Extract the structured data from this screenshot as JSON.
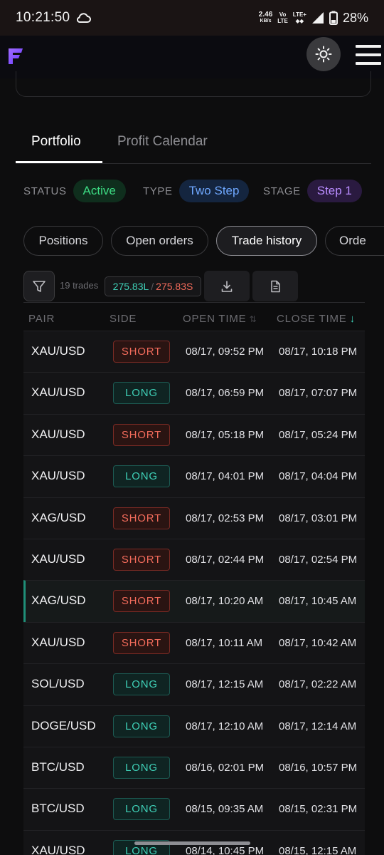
{
  "status_bar": {
    "time": "10:21:50",
    "speed_value": "2.46",
    "speed_unit": "KB/s",
    "volte_top": "Vo",
    "volte_bottom": "LTE",
    "lte_label": "LTE+",
    "battery_percent": "28%",
    "icons": [
      "cloud-icon",
      "signal-icon",
      "battery-icon"
    ]
  },
  "header": {
    "logo_icon": "brand-logo-icon",
    "theme_icon": "sun-icon",
    "menu_icon": "hamburger-menu-icon"
  },
  "tabs": {
    "portfolio": "Portfolio",
    "profit_calendar": "Profit Calendar"
  },
  "meta": {
    "status_label": "STATUS",
    "status_value": "Active",
    "type_label": "TYPE",
    "type_value": "Two Step",
    "stage_label": "STAGE",
    "stage_value": "Step 1"
  },
  "subtabs": {
    "positions": "Positions",
    "open_orders": "Open orders",
    "trade_history": "Trade history",
    "orders_partial": "Orde"
  },
  "toolbar": {
    "trades_count": "19 trades",
    "long_total": "275.83L",
    "separator": "/",
    "short_total": "275.83S",
    "icons": [
      "filter-icon",
      "download-icon",
      "document-icon"
    ]
  },
  "table": {
    "headers": {
      "pair": "PAIR",
      "side": "SIDE",
      "open_time": "OPEN TIME",
      "close_time": "CLOSE TIME",
      "sort_neutral": "⇅",
      "sort_down": "↓"
    },
    "rows": [
      {
        "pair": "XAU/USD",
        "side": "SHORT",
        "open": "08/17, 09:52 PM",
        "close": "08/17, 10:18 PM"
      },
      {
        "pair": "XAU/USD",
        "side": "LONG",
        "open": "08/17, 06:59 PM",
        "close": "08/17, 07:07 PM"
      },
      {
        "pair": "XAU/USD",
        "side": "SHORT",
        "open": "08/17, 05:18 PM",
        "close": "08/17, 05:24 PM"
      },
      {
        "pair": "XAU/USD",
        "side": "LONG",
        "open": "08/17, 04:01 PM",
        "close": "08/17, 04:04 PM"
      },
      {
        "pair": "XAG/USD",
        "side": "SHORT",
        "open": "08/17, 02:53 PM",
        "close": "08/17, 03:01 PM"
      },
      {
        "pair": "XAU/USD",
        "side": "SHORT",
        "open": "08/17, 02:44 PM",
        "close": "08/17, 02:54 PM"
      },
      {
        "pair": "XAG/USD",
        "side": "SHORT",
        "open": "08/17, 10:20 AM",
        "close": "08/17, 10:45 AM"
      },
      {
        "pair": "XAU/USD",
        "side": "SHORT",
        "open": "08/17, 10:11 AM",
        "close": "08/17, 10:42 AM"
      },
      {
        "pair": "SOL/USD",
        "side": "LONG",
        "open": "08/17, 12:15 AM",
        "close": "08/17, 02:22 AM"
      },
      {
        "pair": "DOGE/USD",
        "side": "LONG",
        "open": "08/17, 12:10 AM",
        "close": "08/17, 12:14 AM"
      },
      {
        "pair": "BTC/USD",
        "side": "LONG",
        "open": "08/16, 02:01 PM",
        "close": "08/16, 10:57 PM"
      },
      {
        "pair": "BTC/USD",
        "side": "LONG",
        "open": "08/15, 09:35 AM",
        "close": "08/15, 02:31 PM"
      },
      {
        "pair": "XAU/USD",
        "side": "LONG",
        "open": "08/14, 10:45 PM",
        "close": "08/15, 12:15 AM"
      }
    ],
    "highlighted_row": 6
  },
  "colors": {
    "long": "#3fd1b8",
    "short": "#f26b5b",
    "active": "#3ddc84",
    "type": "#6fa8ff",
    "stage": "#b98cff"
  }
}
